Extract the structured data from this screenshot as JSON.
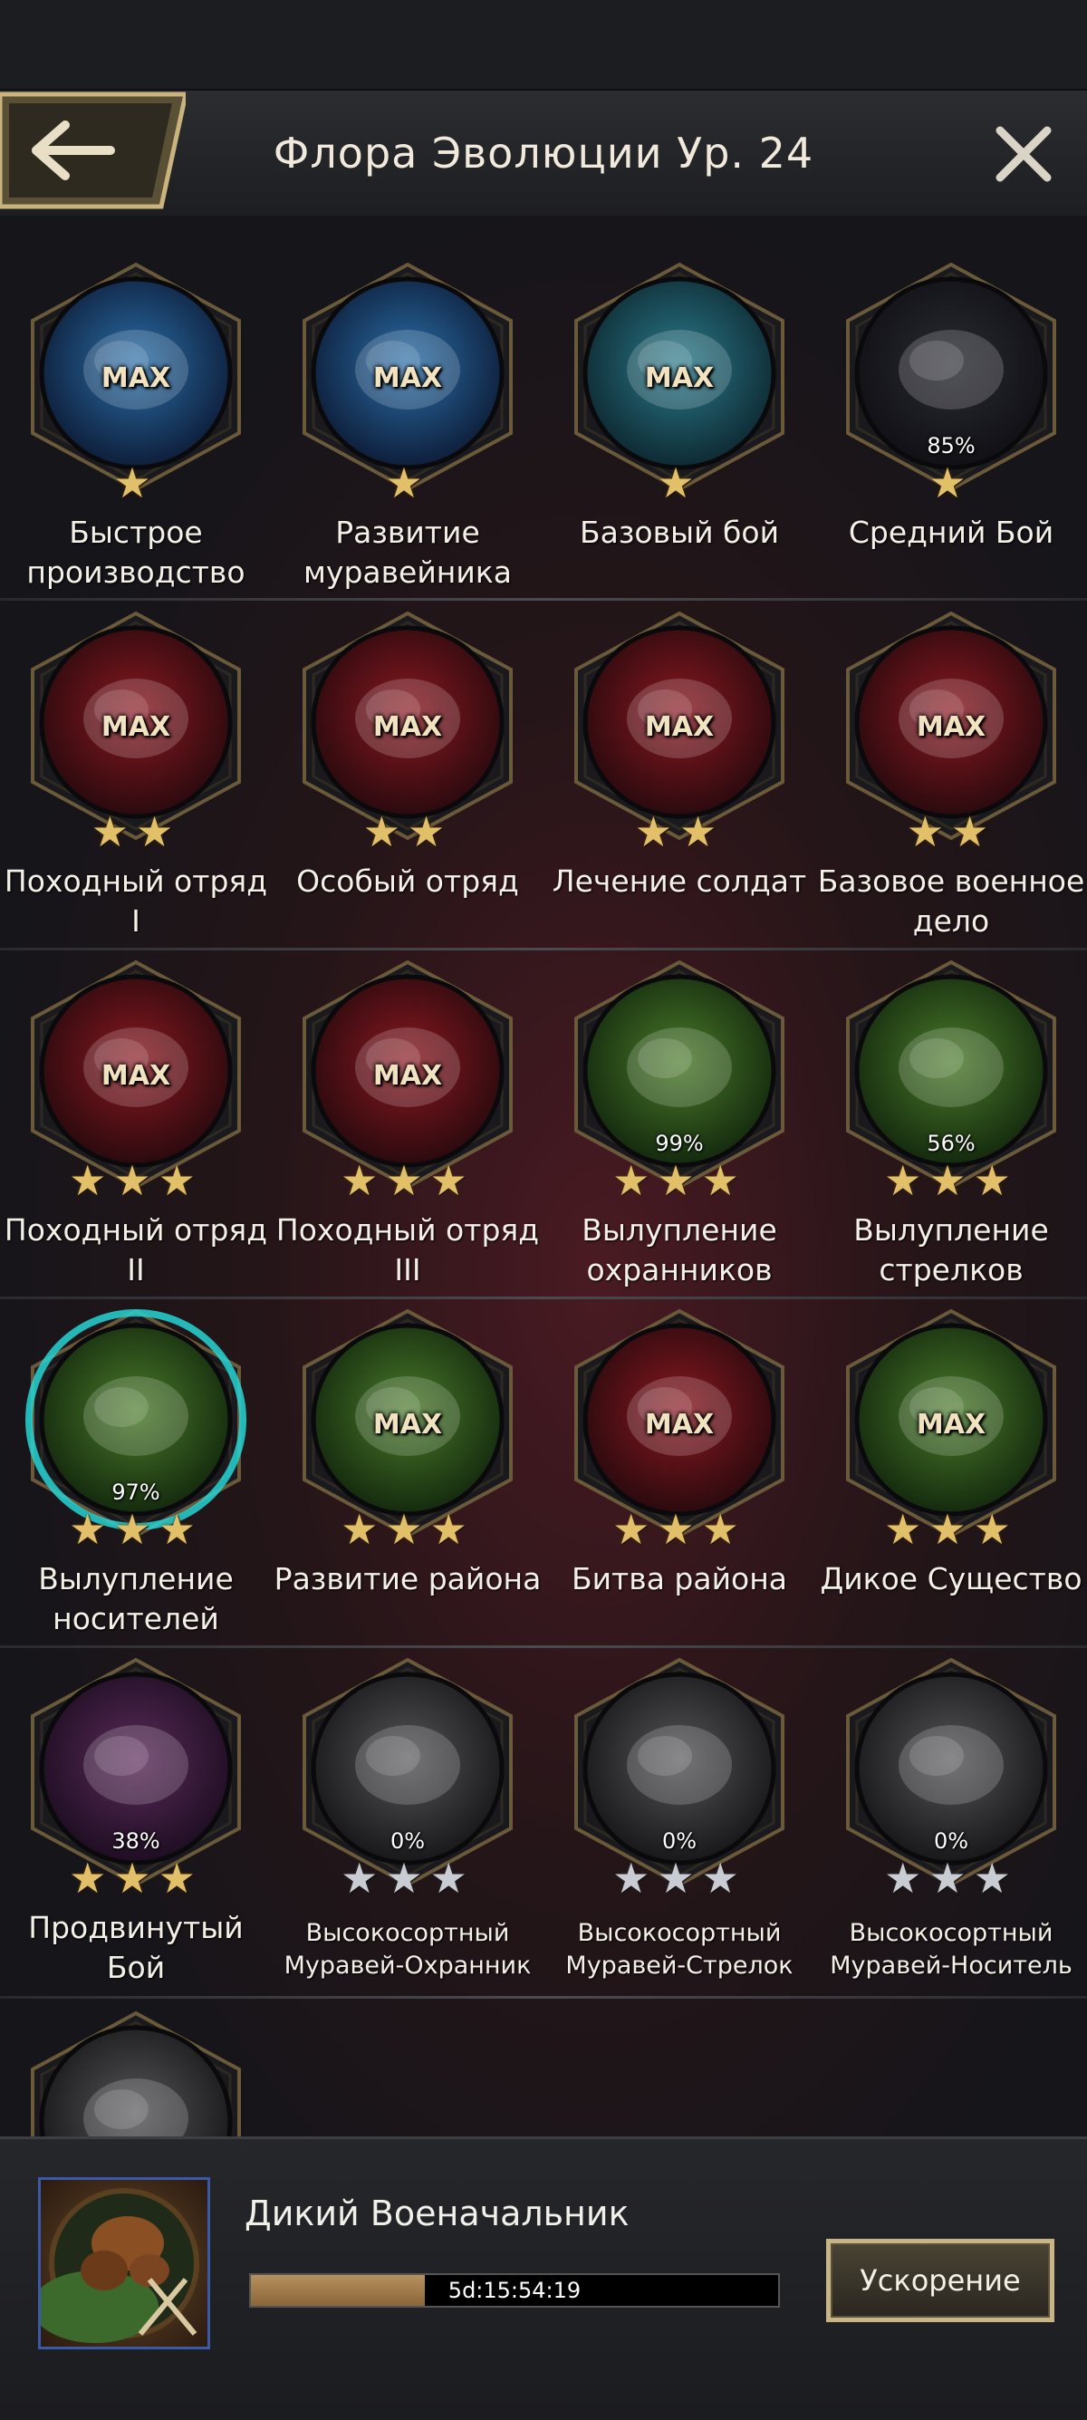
{
  "header": {
    "title": "Флора Эволюции Ур. 24",
    "back_icon": "arrow-left-icon",
    "close_icon": "close-icon"
  },
  "colors": {
    "gold": "#e2c06a",
    "silver": "#c9ccd2",
    "progress_fill": "#a07a4a",
    "active_glow": "#27d3d3"
  },
  "rows": [
    [
      {
        "label": "Быстрое производство",
        "badge": "MAX",
        "pct": "",
        "stars": 1,
        "star_color": "gold",
        "icon": "stopwatch-icon",
        "theme": "blue",
        "small": false,
        "active": false
      },
      {
        "label": "Развитие муравейника",
        "badge": "MAX",
        "pct": "",
        "stars": 1,
        "star_color": "gold",
        "icon": "larva-growth-icon",
        "theme": "blue",
        "small": false,
        "active": false
      },
      {
        "label": "Базовый бой",
        "badge": "MAX",
        "pct": "",
        "stars": 1,
        "star_color": "gold",
        "icon": "crossed-swords-icon",
        "theme": "teal",
        "small": false,
        "active": false
      },
      {
        "label": "Средний Бой",
        "badge": "",
        "pct": "85%",
        "stars": 1,
        "star_color": "gold",
        "icon": "triple-swords-icon",
        "theme": "dark",
        "small": false,
        "active": false
      }
    ],
    [
      {
        "label": "Походный отряд I",
        "badge": "MAX",
        "pct": "",
        "stars": 2,
        "star_color": "gold",
        "icon": "ant-soldier-icon",
        "theme": "red",
        "small": false,
        "active": false
      },
      {
        "label": "Особый отряд",
        "badge": "MAX",
        "pct": "",
        "stars": 2,
        "star_color": "gold",
        "icon": "ant-soldier-icon",
        "theme": "red",
        "small": false,
        "active": false
      },
      {
        "label": "Лечение солдат",
        "badge": "MAX",
        "pct": "",
        "stars": 2,
        "star_color": "gold",
        "icon": "healing-drop-icon",
        "theme": "red",
        "small": false,
        "active": false
      },
      {
        "label": "Базовое военное дело",
        "badge": "MAX",
        "pct": "",
        "stars": 2,
        "star_color": "gold",
        "icon": "crest-swords-icon",
        "theme": "red",
        "small": false,
        "active": false
      }
    ],
    [
      {
        "label": "Походный отряд II",
        "badge": "MAX",
        "pct": "",
        "stars": 3,
        "star_color": "gold",
        "icon": "ant-soldier-icon",
        "theme": "red",
        "small": false,
        "active": false
      },
      {
        "label": "Походный отряд III",
        "badge": "MAX",
        "pct": "",
        "stars": 3,
        "star_color": "gold",
        "icon": "ant-soldier-icon",
        "theme": "red",
        "small": false,
        "active": false
      },
      {
        "label": "Вылупление охранников",
        "badge": "",
        "pct": "99%",
        "stars": 3,
        "star_color": "gold",
        "icon": "cocoon-guard-icon",
        "theme": "green",
        "small": false,
        "active": false
      },
      {
        "label": "Вылупление стрелков",
        "badge": "",
        "pct": "56%",
        "stars": 3,
        "star_color": "gold",
        "icon": "cocoon-shooter-icon",
        "theme": "green",
        "small": false,
        "active": false
      }
    ],
    [
      {
        "label": "Вылупление носителей",
        "badge": "",
        "pct": "97%",
        "stars": 3,
        "star_color": "gold",
        "icon": "cocoon-carrier-icon",
        "theme": "green",
        "small": false,
        "active": true
      },
      {
        "label": "Развитие района",
        "badge": "MAX",
        "pct": "",
        "stars": 3,
        "star_color": "gold",
        "icon": "pinecone-icon",
        "theme": "green",
        "small": false,
        "active": false
      },
      {
        "label": "Битва района",
        "badge": "MAX",
        "pct": "",
        "stars": 3,
        "star_color": "gold",
        "icon": "skull-claws-icon",
        "theme": "red",
        "small": false,
        "active": false
      },
      {
        "label": "Дикое Существо",
        "badge": "MAX",
        "pct": "",
        "stars": 3,
        "star_color": "gold",
        "icon": "beetle-icon",
        "theme": "green",
        "small": false,
        "active": false
      }
    ],
    [
      {
        "label": "Продвинутый Бой",
        "badge": "",
        "pct": "38%",
        "stars": 3,
        "star_color": "gold",
        "icon": "triple-swords-icon",
        "theme": "purple",
        "small": false,
        "active": false
      },
      {
        "label": "Высокосортный Муравей-Охранник",
        "badge": "",
        "pct": "0%",
        "stars": 3,
        "star_color": "silver",
        "icon": "ant-guard-gray-icon",
        "theme": "gray",
        "small": true,
        "active": false
      },
      {
        "label": "Высокосортный Муравей-Стрелок",
        "badge": "",
        "pct": "0%",
        "stars": 3,
        "star_color": "silver",
        "icon": "ant-shooter-gray-icon",
        "theme": "gray",
        "small": true,
        "active": false
      },
      {
        "label": "Высокосортный Муравей-Носитель",
        "badge": "",
        "pct": "0%",
        "stars": 3,
        "star_color": "silver",
        "icon": "ant-carrier-gray-icon",
        "theme": "gray",
        "small": true,
        "active": false
      }
    ],
    [
      {
        "label": "",
        "badge": "",
        "pct": "",
        "stars": 0,
        "star_color": "silver",
        "icon": "ant-group-gray-icon",
        "theme": "gray",
        "small": false,
        "active": false
      }
    ]
  ],
  "bottom": {
    "research_name": "Дикий Военачальник",
    "timer": "5d:15:54:19",
    "progress": 0.33,
    "speedup_label": "Ускорение",
    "portrait_icon": "ant-warlord-portrait-icon"
  }
}
